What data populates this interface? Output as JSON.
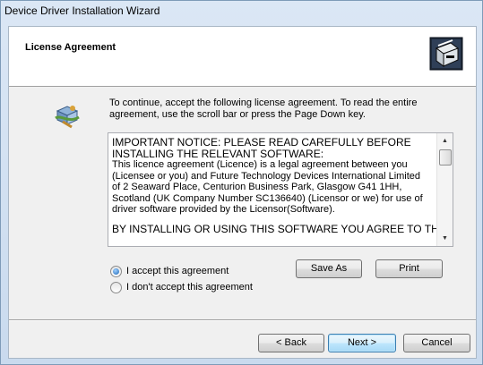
{
  "window": {
    "title": "Device Driver Installation Wizard"
  },
  "header": {
    "title": "License Agreement",
    "icon": "computer-setup-icon"
  },
  "body": {
    "icon": "wizard-package-icon",
    "instructions": "To continue, accept the following license agreement. To read the entire agreement, use the scroll bar or press the Page Down key."
  },
  "license": {
    "lead": "IMPORTANT NOTICE: PLEASE READ CAREFULLY BEFORE INSTALLING THE RELEVANT SOFTWARE:",
    "paragraph": "This licence agreement (Licence) is a legal agreement between you (Licensee or you) and Future Technology Devices International Limited of 2 Seaward Place, Centurion Business Park, Glasgow G41 1HH, Scotland (UK Company Number SC136640) (Licensor or we) for use of driver software provided by the Licensor(Software).",
    "final": "BY INSTALLING OR USING THIS SOFTWARE YOU AGREE TO THE"
  },
  "options": {
    "accept_label": "I accept this agreement",
    "decline_label": "I don't accept this agreement",
    "selected": "accept"
  },
  "buttons": {
    "save_as": "Save As",
    "print": "Print",
    "back": "< Back",
    "next": "Next >",
    "cancel": "Cancel"
  }
}
